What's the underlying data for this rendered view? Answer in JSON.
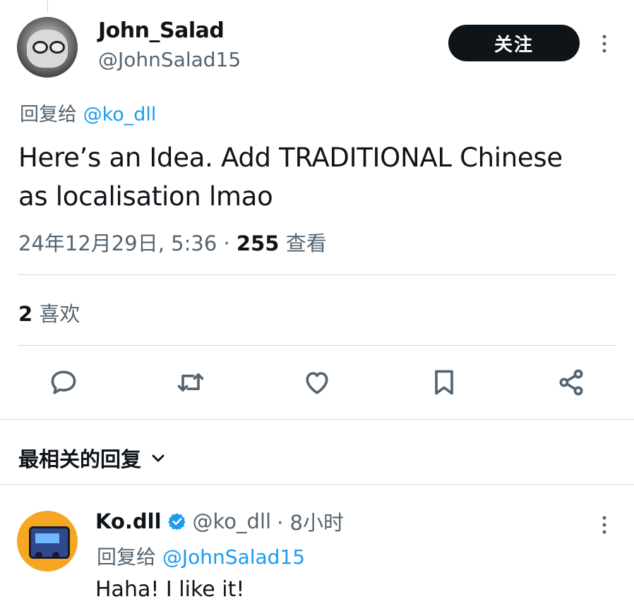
{
  "tweet": {
    "author": {
      "display_name": "John_Salad",
      "handle": "@JohnSalad15"
    },
    "follow_label": "关注",
    "reply_to_prefix": "回复给",
    "reply_to_handle": "@ko_dll",
    "text_line1": "Here’s an Idea. Add TRADITIONAL Chinese",
    "text_line2": "as localisation lmao",
    "timestamp": "24年12月29日, 5:36 ·",
    "views_count": "255",
    "views_label": "查看",
    "likes_count": "2",
    "likes_label": "喜欢"
  },
  "actions": [
    "reply-icon",
    "retweet-icon",
    "like-icon",
    "bookmark-icon",
    "share-icon"
  ],
  "sort": {
    "label": "最相关的回复"
  },
  "reply": {
    "display_name": "Ko.dll",
    "handle": "@ko_dll",
    "time": "· 8小时",
    "reply_to_prefix": "回复给",
    "reply_to_handle": "@JohnSalad15",
    "text": "Haha! I like it!"
  },
  "colors": {
    "accent": "#1d9bf0",
    "text": "#0f1419",
    "muted": "#536471",
    "divider": "#cfd9de"
  }
}
